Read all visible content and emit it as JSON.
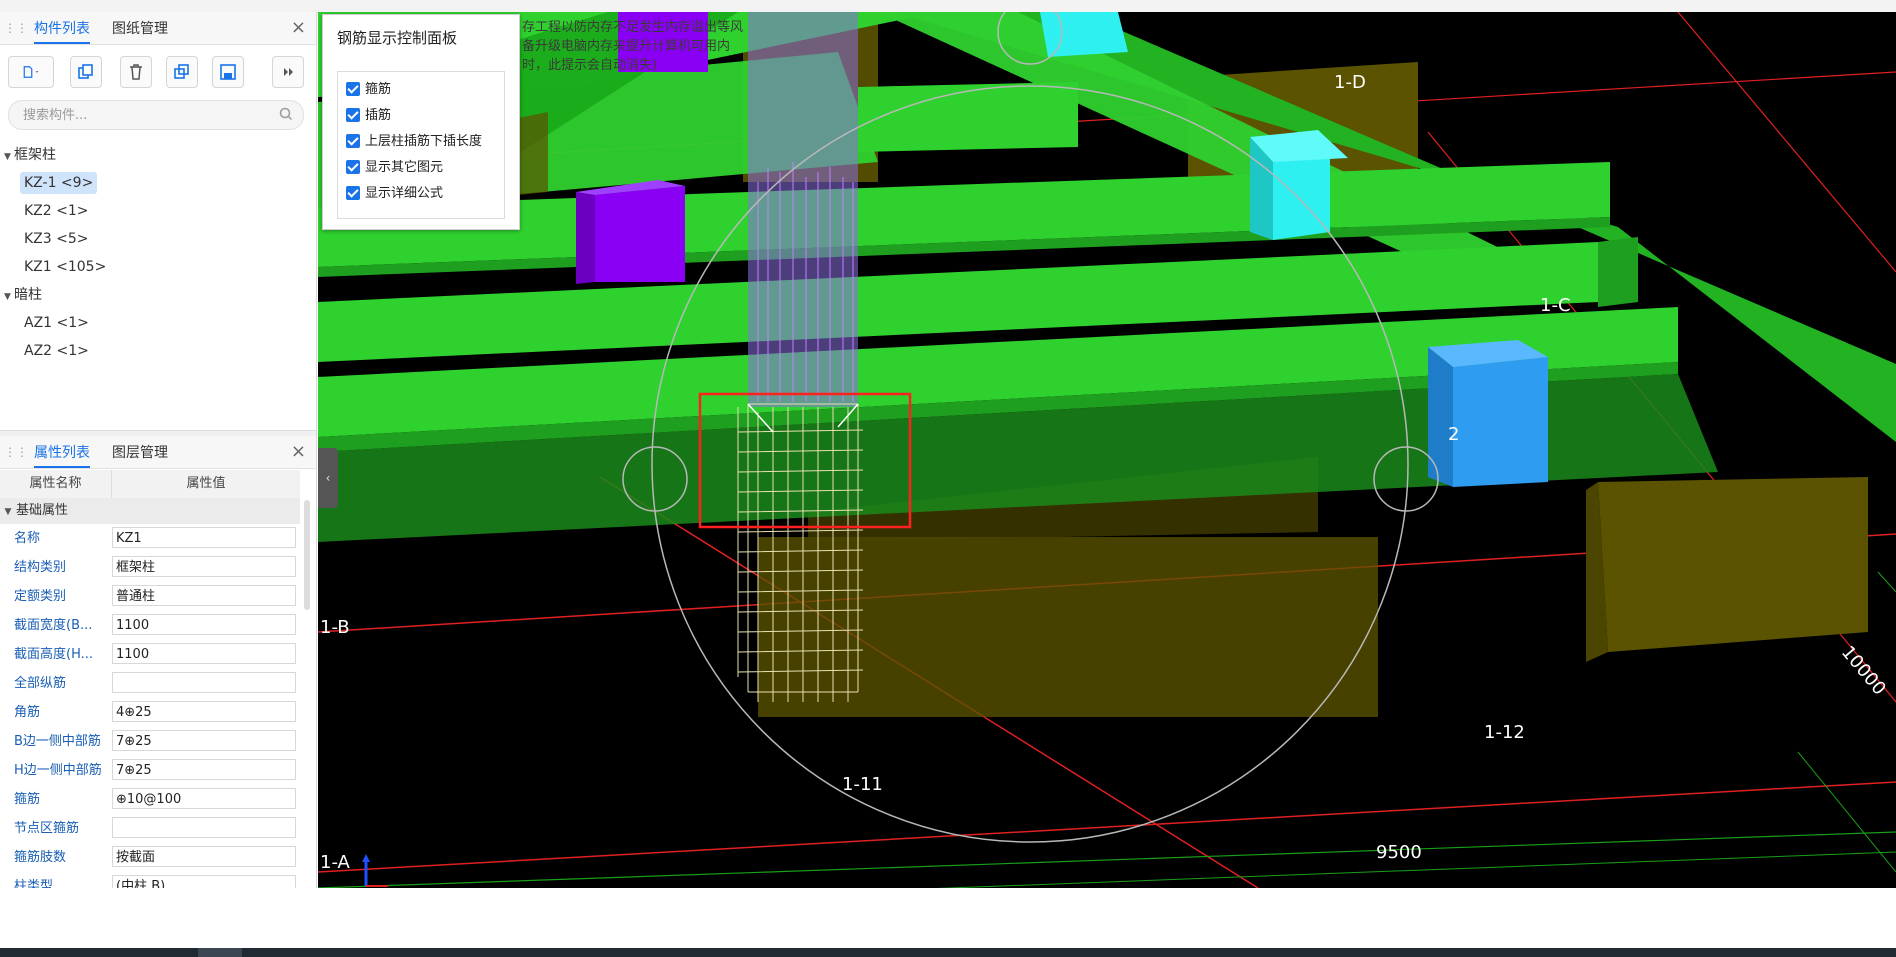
{
  "component_panel": {
    "tabs": [
      "构件列表",
      "图纸管理"
    ],
    "search_placeholder": "搜索构件...",
    "tree": [
      {
        "category": "框架柱",
        "items": [
          "KZ-1 <9>",
          "KZ2 <1>",
          "KZ3 <5>",
          "KZ1 <105>"
        ],
        "selected": "KZ-1 <9>"
      },
      {
        "category": "暗柱",
        "items": [
          "AZ1 <1>",
          "AZ2 <1>"
        ]
      }
    ]
  },
  "property_panel": {
    "tabs": [
      "属性列表",
      "图层管理"
    ],
    "headers": {
      "name": "属性名称",
      "value": "属性值"
    },
    "group": "基础属性",
    "rows": [
      {
        "name": "名称",
        "value": "KZ1"
      },
      {
        "name": "结构类别",
        "value": "框架柱"
      },
      {
        "name": "定额类别",
        "value": "普通柱"
      },
      {
        "name": "截面宽度(B...",
        "value": "1100"
      },
      {
        "name": "截面高度(H...",
        "value": "1100"
      },
      {
        "name": "全部纵筋",
        "value": ""
      },
      {
        "name": "角筋",
        "value": "4⊕25"
      },
      {
        "name": "B边一侧中部筋",
        "value": "7⊕25"
      },
      {
        "name": "H边一侧中部筋",
        "value": "7⊕25"
      },
      {
        "name": "箍筋",
        "value": "⊕10@100"
      },
      {
        "name": "节点区箍筋",
        "value": ""
      },
      {
        "name": "箍筋肢数",
        "value": "按截面"
      },
      {
        "name": "柱类型",
        "value": "(中柱 B)"
      }
    ]
  },
  "rebar_control_panel": {
    "title": "钢筋显示控制面板",
    "options": [
      {
        "label": "箍筋",
        "checked": true
      },
      {
        "label": "插筋",
        "checked": true
      },
      {
        "label": "上层柱插筋下插长度",
        "checked": true
      },
      {
        "label": "显示其它图元",
        "checked": true
      },
      {
        "label": "显示详细公式",
        "checked": true
      }
    ]
  },
  "warning_text": [
    "存工程以防内存不足发生内存溢出等风",
    "备升级电脑内存来提升计算机可用内",
    "时，此提示会自动消失)"
  ],
  "viewport": {
    "axis_labels": {
      "a1": "1-A",
      "b1": "1-B",
      "c1": "1-C",
      "d1": "1-D",
      "n11": "1-11",
      "n12": "1-12",
      "dim": "9500",
      "dim2": "10000",
      "edge": "2"
    },
    "colors": {
      "beam": "#2fd12f",
      "column_purple": "#8a00f5",
      "cyan": "#2ff0f0",
      "blue": "#2e9cf0",
      "footing": "#5b5300",
      "selection": "#ff2020"
    }
  }
}
